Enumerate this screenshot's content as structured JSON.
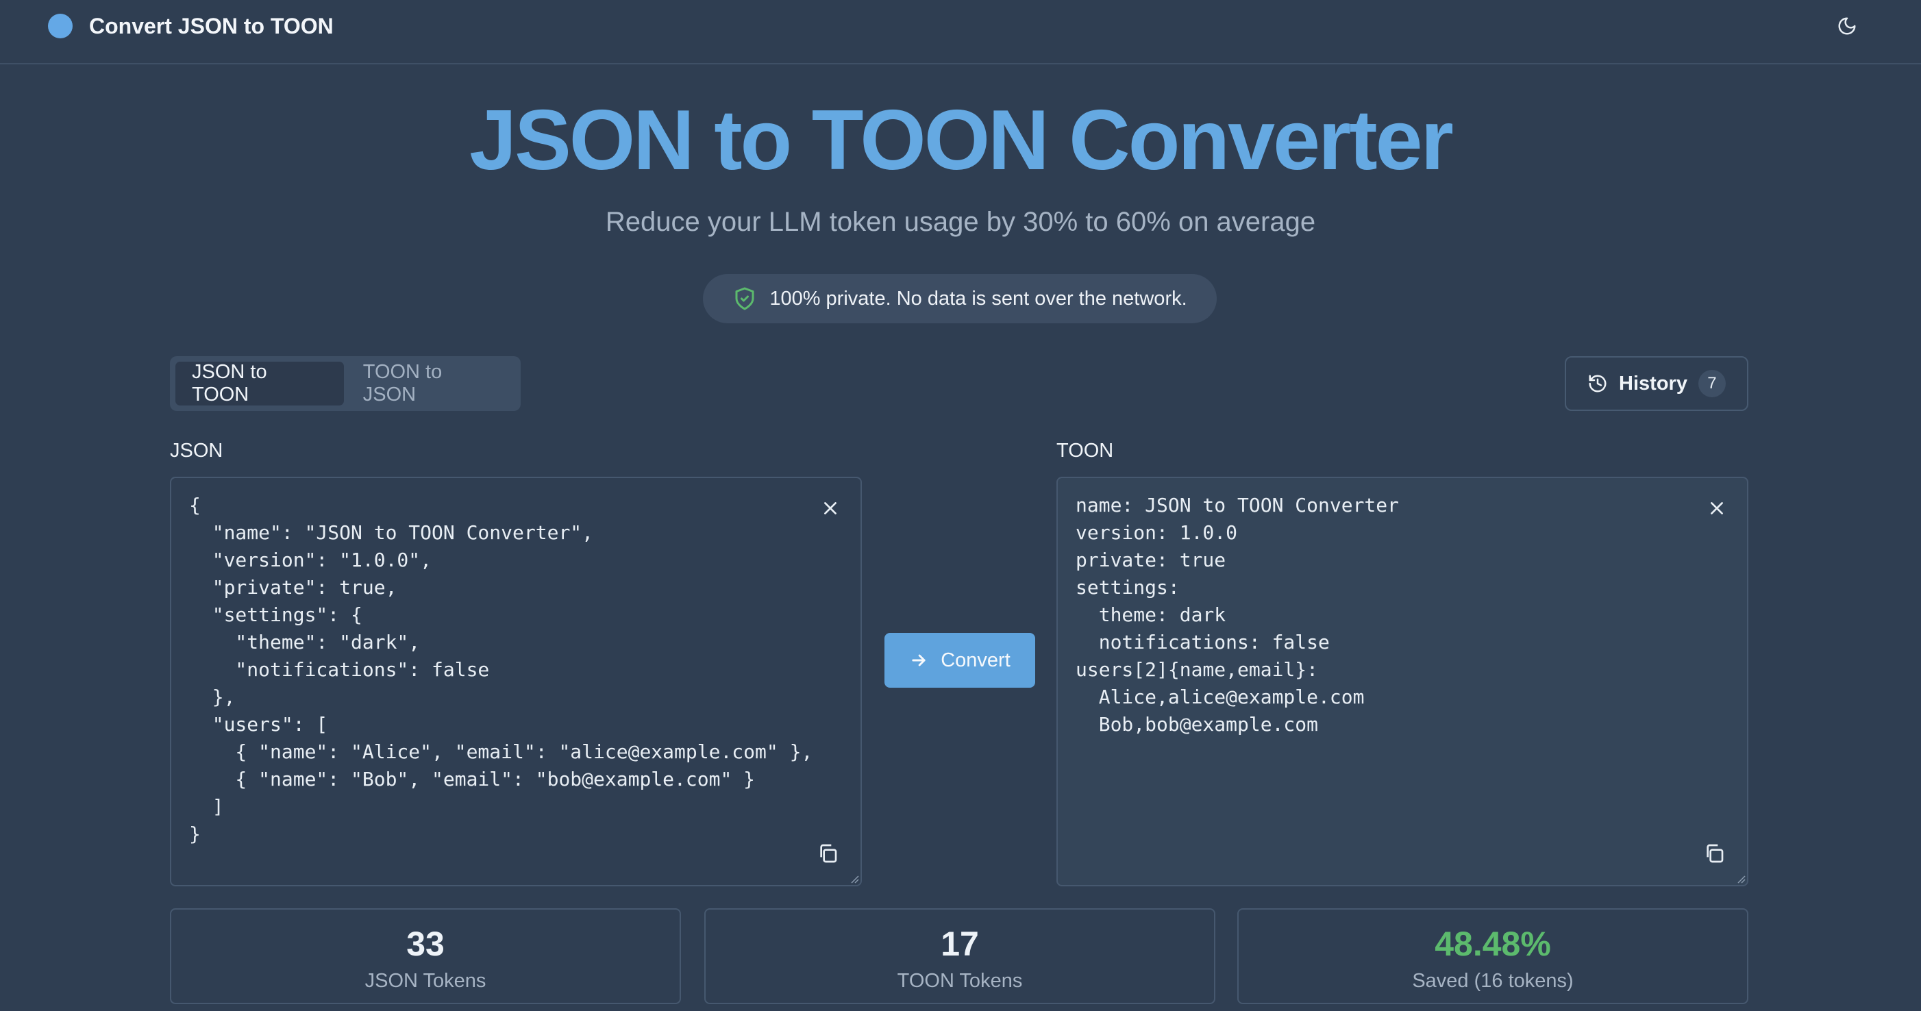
{
  "header": {
    "title": "Convert JSON to TOON",
    "theme_icon": "moon-icon"
  },
  "hero": {
    "title": "JSON to TOON Converter",
    "subtitle": "Reduce your LLM token usage by 30% to 60% on average",
    "privacy": "100% private. No data is sent over the network."
  },
  "tabs": [
    {
      "label": "JSON to TOON",
      "active": true
    },
    {
      "label": "TOON to JSON",
      "active": false
    }
  ],
  "history": {
    "label": "History",
    "count": "7"
  },
  "input": {
    "label": "JSON",
    "content": "{\n  \"name\": \"JSON to TOON Converter\",\n  \"version\": \"1.0.0\",\n  \"private\": true,\n  \"settings\": {\n    \"theme\": \"dark\",\n    \"notifications\": false\n  },\n  \"users\": [\n    { \"name\": \"Alice\", \"email\": \"alice@example.com\" },\n    { \"name\": \"Bob\", \"email\": \"bob@example.com\" }\n  ]\n}"
  },
  "output": {
    "label": "TOON",
    "content": "name: JSON to TOON Converter\nversion: 1.0.0\nprivate: true\nsettings:\n  theme: dark\n  notifications: false\nusers[2]{name,email}:\n  Alice,alice@example.com\n  Bob,bob@example.com"
  },
  "convert": {
    "label": "Convert"
  },
  "stats": [
    {
      "value": "33",
      "caption": "JSON Tokens"
    },
    {
      "value": "17",
      "caption": "TOON Tokens"
    },
    {
      "value": "48.48%",
      "caption": "Saved (16 tokens)"
    }
  ],
  "colors": {
    "accent": "#65a9e2",
    "success": "#5cba6d",
    "background": "#2f3e52"
  }
}
